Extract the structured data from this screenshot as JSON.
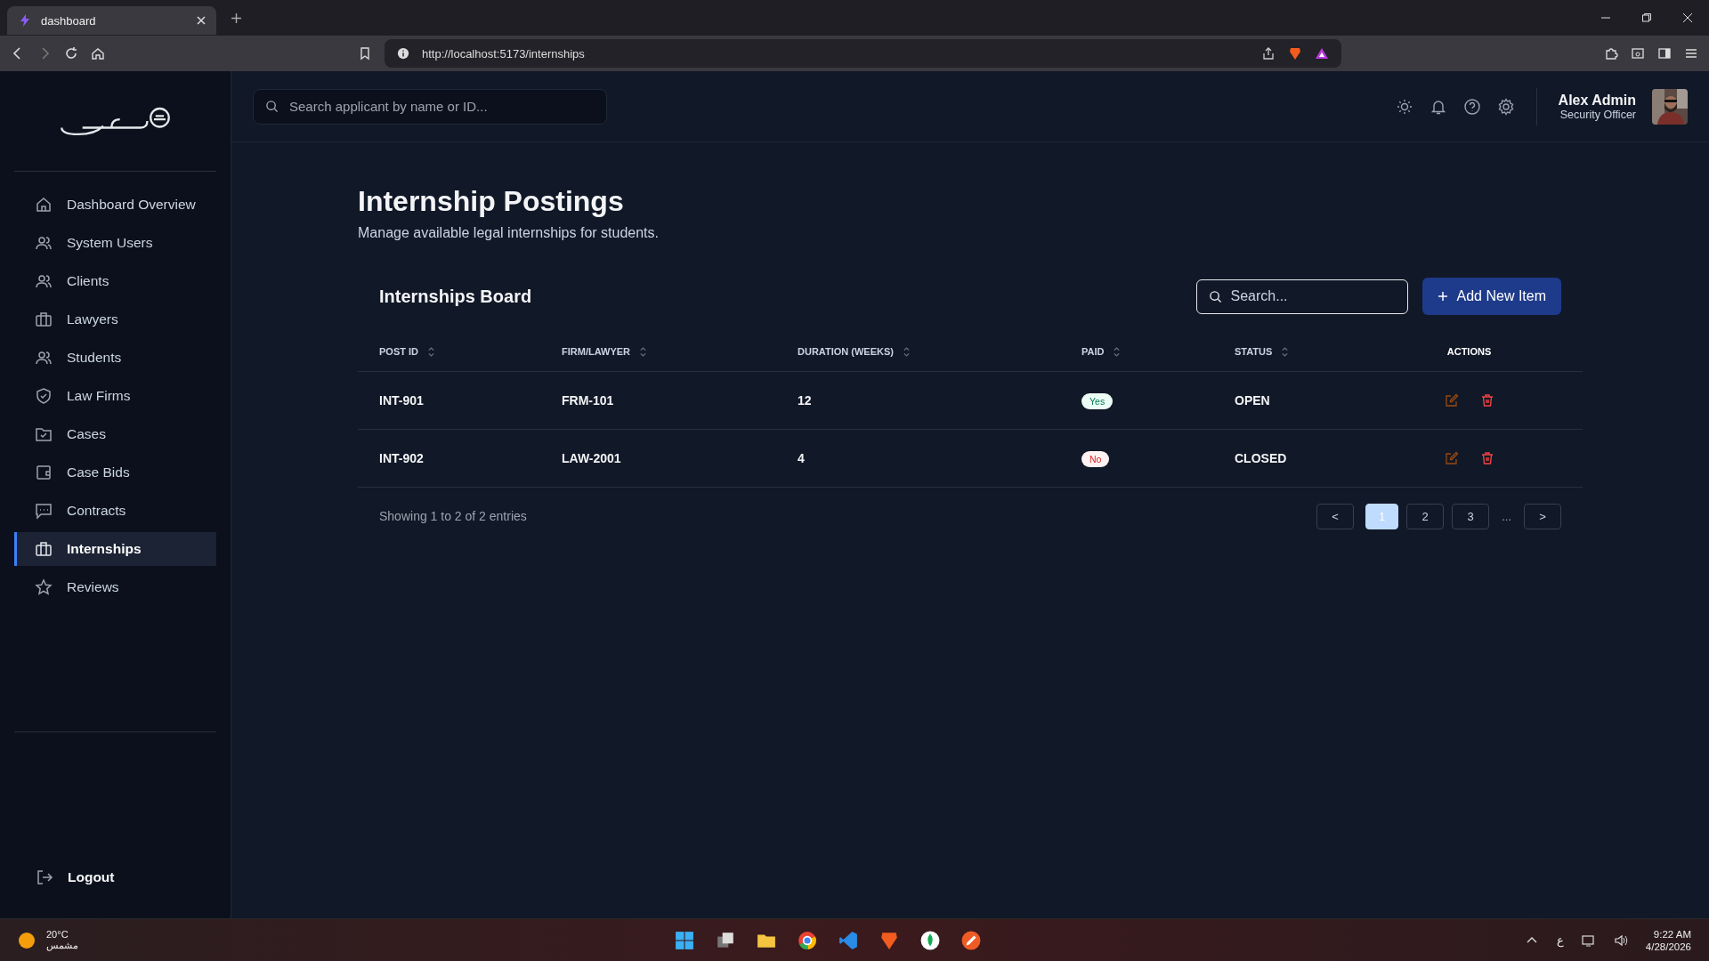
{
  "browser": {
    "tab_title": "dashboard",
    "url": "http://localhost:5173/internships"
  },
  "sidebar": {
    "items": [
      {
        "label": "Dashboard Overview",
        "kind": "home",
        "selected": false
      },
      {
        "label": "System Users",
        "kind": "users",
        "selected": false
      },
      {
        "label": "Clients",
        "kind": "users",
        "selected": false
      },
      {
        "label": "Lawyers",
        "kind": "briefcase",
        "selected": false
      },
      {
        "label": "Students",
        "kind": "users",
        "selected": false
      },
      {
        "label": "Law Firms",
        "kind": "shield",
        "selected": false
      },
      {
        "label": "Cases",
        "kind": "folder",
        "selected": false
      },
      {
        "label": "Case Bids",
        "kind": "wallet",
        "selected": false
      },
      {
        "label": "Contracts",
        "kind": "chat",
        "selected": false
      },
      {
        "label": "Internships",
        "kind": "briefcase",
        "selected": true
      },
      {
        "label": "Reviews",
        "kind": "star",
        "selected": false
      }
    ],
    "logout": "Logout"
  },
  "header": {
    "search": {
      "placeholder": "Search applicant by name or ID..."
    },
    "user": {
      "name": "Alex Admin",
      "role": "Security Officer"
    }
  },
  "page": {
    "title": "Internship Postings",
    "subtitle": "Manage available legal internships for students."
  },
  "board": {
    "title": "Internships Board",
    "search": {
      "placeholder": "Search..."
    },
    "add_button": "Add New Item",
    "columns": [
      "POST ID",
      "FIRM/LAWYER",
      "DURATION (WEEKS)",
      "PAID",
      "STATUS",
      "ACTIONS"
    ],
    "rows": [
      {
        "post_id": "INT-901",
        "firm": "FRM-101",
        "duration": "12",
        "paid": {
          "label": "Yes",
          "on": true
        },
        "status": "OPEN"
      },
      {
        "post_id": "INT-902",
        "firm": "LAW-2001",
        "duration": "4",
        "paid": {
          "label": "No",
          "on": false
        },
        "status": "CLOSED"
      }
    ],
    "footer": "Showing 1 to 2 of 2 entries",
    "pagination": {
      "prev": "<",
      "pages": [
        {
          "label": "1",
          "selected": true
        },
        {
          "label": "2",
          "selected": false
        },
        {
          "label": "3",
          "selected": false
        }
      ],
      "ellipsis": "...",
      "next": ">"
    }
  },
  "taskbar": {
    "weather": {
      "temp": "20°C",
      "condition": "مشمس"
    },
    "language": "ع",
    "time": "9:22 AM",
    "date": "4/28/2026"
  }
}
